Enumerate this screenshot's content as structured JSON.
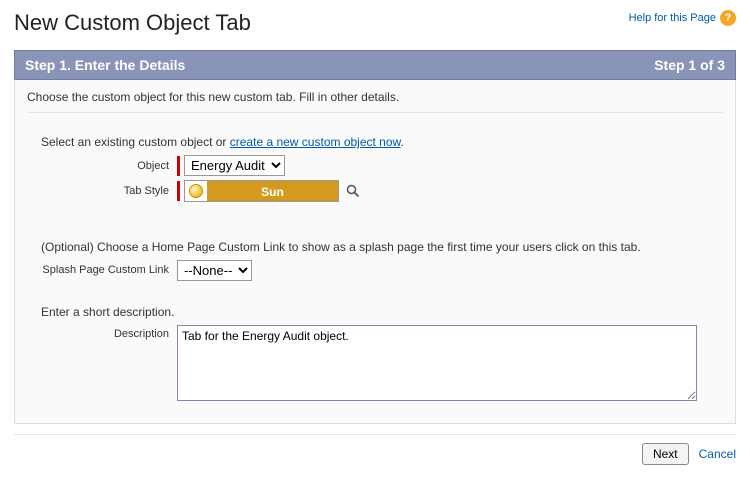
{
  "page": {
    "title": "New Custom Object Tab",
    "help_link": "Help for this Page"
  },
  "step": {
    "title": "Step 1. Enter the Details",
    "progress": "Step 1 of 3"
  },
  "instruction": "Choose the custom object for this new custom tab. Fill in other details.",
  "object_section": {
    "prompt_prefix": "Select an existing custom object or ",
    "create_link": "create a new custom object now",
    "prompt_suffix": ".",
    "object_label": "Object",
    "object_value": "Energy Audit",
    "tab_style_label": "Tab Style",
    "tab_style_value": "Sun"
  },
  "splash_section": {
    "prompt": "(Optional) Choose a Home Page Custom Link to show as a splash page the first time your users click on this tab.",
    "label": "Splash Page Custom Link",
    "value": "--None--"
  },
  "description_section": {
    "prompt": "Enter a short description.",
    "label": "Description",
    "value": "Tab for the Energy Audit object."
  },
  "footer": {
    "next": "Next",
    "cancel": "Cancel"
  }
}
